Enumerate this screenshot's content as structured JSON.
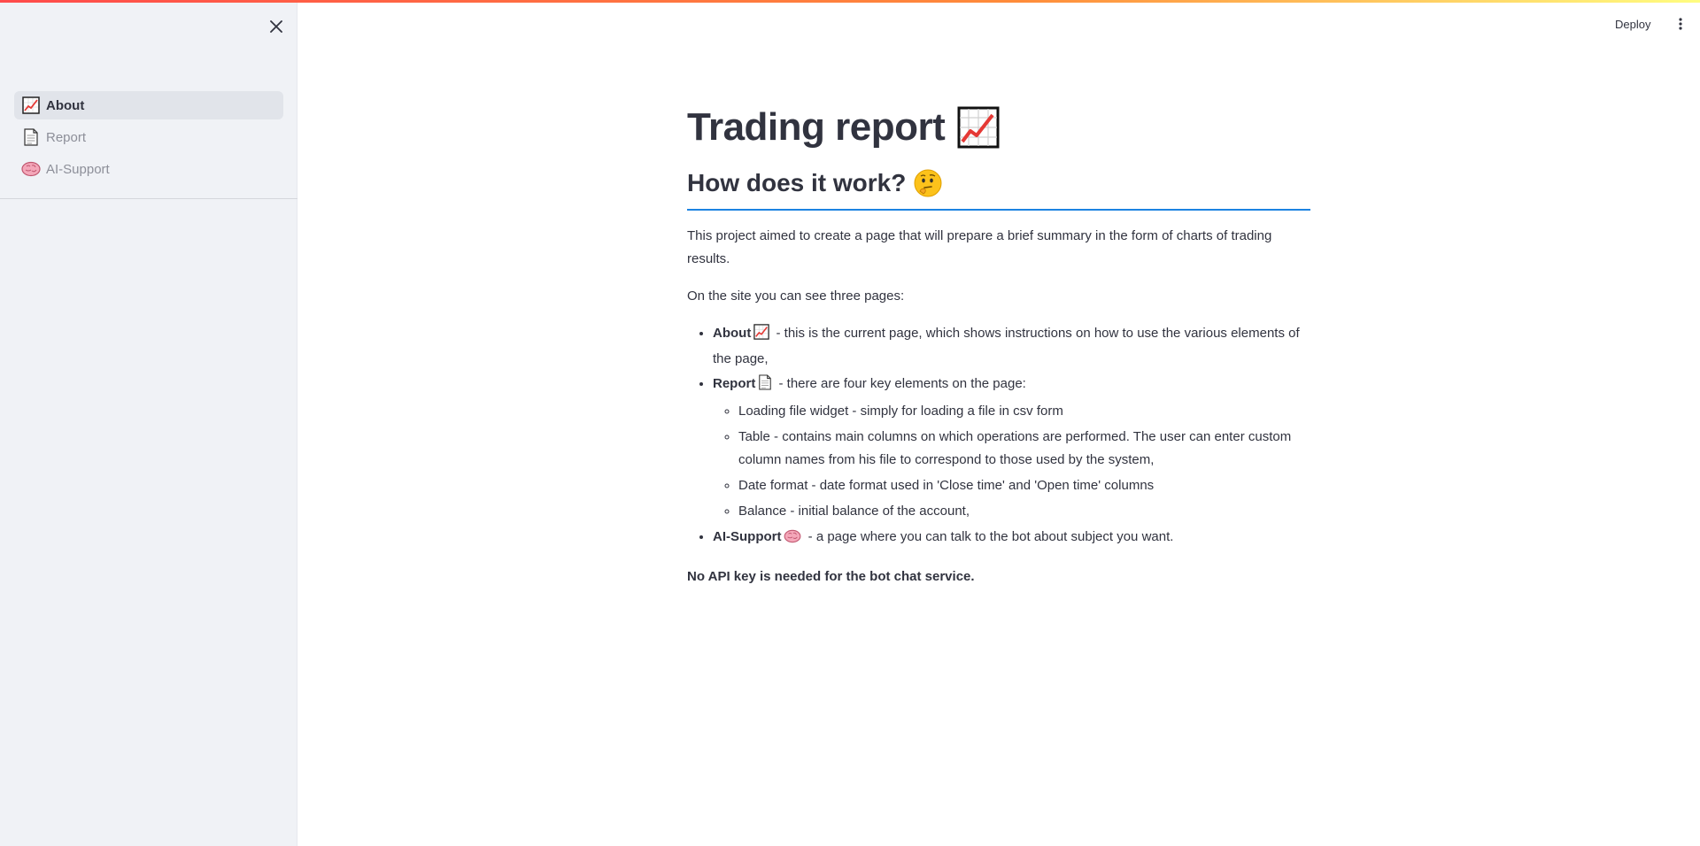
{
  "topbar": {
    "deploy_label": "Deploy"
  },
  "sidebar": {
    "items": [
      {
        "label": "About",
        "icon": "chart-increasing-icon",
        "active": true
      },
      {
        "label": "Report",
        "icon": "page-icon",
        "active": false
      },
      {
        "label": "AI-Support",
        "icon": "brain-icon",
        "active": false
      }
    ]
  },
  "main": {
    "title": "Trading report",
    "subtitle": "How does it work?",
    "intro": "This project aimed to create a page that will prepare a brief summary in the form of charts of trading results.",
    "pages_intro": "On the site you can see three pages:",
    "bullets": {
      "about_label": "About",
      "about_text": " - this is the current page, which shows instructions on how to use the various elements of the page,",
      "report_label": "Report",
      "report_text": " - there are four key elements on the page:",
      "report_sub": [
        "Loading file widget - simply for loading a file in csv form",
        "Table - contains main columns on which operations are performed. The user can enter custom column names from his file to correspond to those used by the system,",
        "Date format - date format used in 'Close time' and 'Open time' columns",
        "Balance - initial balance of the account,"
      ],
      "ai_label": "AI-Support",
      "ai_text": " - a page where you can talk to the bot about subject you want."
    },
    "note": "No API key is needed for the bot chat service."
  },
  "colors": {
    "accent": "#1c83e1",
    "sidebar_bg": "#f0f2f6",
    "text": "#31333f",
    "muted": "#8d8f99"
  }
}
